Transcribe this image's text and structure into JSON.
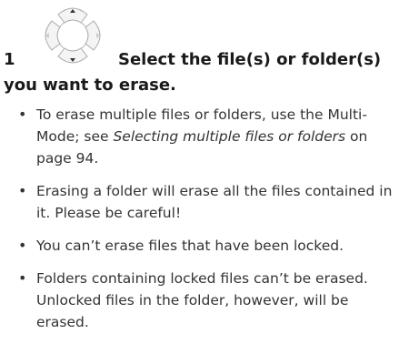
{
  "step": {
    "number": "1",
    "line1": "Select the file(s) or folder(s)",
    "line2": "you want to erase."
  },
  "dpad_icon": "dpad-arrows-icon",
  "bullets": [
    {
      "parts": [
        {
          "text": "To erase multiple files or folders, use the Multi-Mode; see ",
          "italic": false
        },
        {
          "text": "Selecting multiple files or folders",
          "italic": true
        },
        {
          "text": " on page 94.",
          "italic": false
        }
      ]
    },
    {
      "parts": [
        {
          "text": "Erasing a folder will erase all the files contained in it. Please be careful!",
          "italic": false
        }
      ]
    },
    {
      "parts": [
        {
          "text": "You can’t erase files that have been locked.",
          "italic": false
        }
      ]
    },
    {
      "parts": [
        {
          "text": "Folders containing locked files can’t be erased. Unlocked files in the folder, however, will be erased.",
          "italic": false
        }
      ]
    }
  ]
}
